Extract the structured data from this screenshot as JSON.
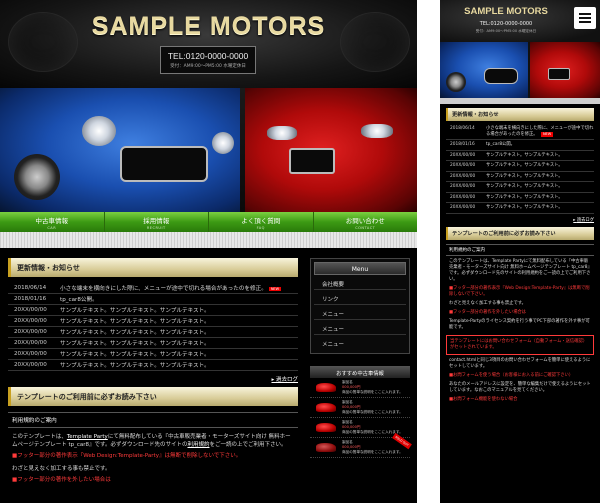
{
  "brand": {
    "logo": "SAMPLE MOTORS",
    "tel": "TEL:0120-0000-0000",
    "hours": "受付：AM9:00〜PM5:00 水曜定休日"
  },
  "nav": [
    {
      "label": "中古車情報",
      "sub": "CAR"
    },
    {
      "label": "採用情報",
      "sub": "RECRUIT"
    },
    {
      "label": "よく頂く質問",
      "sub": "FAQ"
    },
    {
      "label": "お問い合わせ",
      "sub": "CONTACT"
    }
  ],
  "news": {
    "title": "更新情報・お知らせ",
    "items": [
      {
        "date": "2018/06/14",
        "text": "小さな端末を横向きにした際に、メニューが途中で切れる場合があったのを修正。",
        "new": "NEW"
      },
      {
        "date": "2018/01/16",
        "text": "tp_car8公開。"
      },
      {
        "date": "20XX/00/00",
        "text": "サンプルテキスト。サンプルテキスト。サンプルテキスト。"
      },
      {
        "date": "20XX/00/00",
        "text": "サンプルテキスト。サンプルテキスト。サンプルテキスト。"
      },
      {
        "date": "20XX/00/00",
        "text": "サンプルテキスト。サンプルテキスト。サンプルテキスト。"
      },
      {
        "date": "20XX/00/00",
        "text": "サンプルテキスト。サンプルテキスト。サンプルテキスト。"
      },
      {
        "date": "20XX/00/00",
        "text": "サンプルテキスト。サンプルテキスト。サンプルテキスト。"
      },
      {
        "date": "20XX/00/00",
        "text": "サンプルテキスト。サンプルテキスト。サンプルテキスト。"
      }
    ],
    "archive": "過去ログ"
  },
  "template": {
    "title": "テンプレートのご利用前に必ずお読み下さい",
    "subhead": "利用規約のご案内",
    "p1_pre": "このテンプレートは、",
    "p1_link": "Template Party",
    "p1_mid": "にて無料配布している『中古車販売業者・モーターズサイト向け 無料ホームページテンプレート tp_car8』です。必ずダウンロード先のサイトの",
    "p1_link2": "利用規約",
    "p1_post": "をご一読の上でご利用下さい。",
    "red1": "■フッター部分の著作表示『Web Design:Template-Party』は無断で削除しないで下さい。",
    "p2": "わざと見えなく加工する事も禁止です。",
    "red2": "■フッター部分の著作を外したい場合は"
  },
  "side": {
    "menu_title": "Menu",
    "menu": [
      "会社概要",
      "リンク",
      "メニュー",
      "メニュー",
      "メニュー"
    ],
    "rec_title": "おすすめ中古車情報",
    "rec_items": [
      {
        "name": "製品名",
        "price": "000,000円",
        "desc": "商品の簡単な説明をここに入れます。",
        "ribbon": ""
      },
      {
        "name": "製品名",
        "price": "000,000円",
        "desc": "商品の簡単な説明をここに入れます。",
        "ribbon": ""
      },
      {
        "name": "製品名",
        "price": "000,000円",
        "desc": "商品の簡単な説明をここに入れます。",
        "ribbon": ""
      },
      {
        "name": "製品名",
        "price": "000,000円",
        "desc": "商品の簡単な説明をここに入れます。",
        "ribbon": "SOLD OUT"
      }
    ]
  },
  "mobile": {
    "news_items": [
      {
        "date": "2018/06/14",
        "text": "小さな端末を横向きにした際に、メニューが途中で切れる場合があったのを修正。",
        "new": "NEW"
      },
      {
        "date": "2018/01/16",
        "text": "tp_car8公開。"
      },
      {
        "date": "20XX/00/00",
        "text": "サンプルテキスト。サンプルテキスト。"
      },
      {
        "date": "20XX/00/00",
        "text": "サンプルテキスト。サンプルテキスト。"
      },
      {
        "date": "20XX/00/00",
        "text": "サンプルテキスト。サンプルテキスト。"
      },
      {
        "date": "20XX/00/00",
        "text": "サンプルテキスト。サンプルテキスト。"
      },
      {
        "date": "20XX/00/00",
        "text": "サンプルテキスト。サンプルテキスト。"
      },
      {
        "date": "20XX/00/00",
        "text": "サンプルテキスト。サンプルテキスト。"
      }
    ],
    "p1": "このテンプレートは、Template Partyにて無料配布している『中古車販売業者・モーターズサイト向け 無料ホームページテンプレート tp_car8』です。必ずダウンロード先のサイトの利用規約をご一読の上でご利用下さい。",
    "red1": "■フッター部分の著作表示『Web Design:Template-Party』は無断で削除しないで下さい。",
    "p2": "わざと見えなく加工する事も禁止です。",
    "red2": "■フッター部分の著作を外したい場合は",
    "p3": "Template-Partyのライセンス契約を行う事でPC下部の著作を外す事が可能です。",
    "red_box": "当テンプレートにはお問い合わせフォーム（自動フォーム・送信確認）がセットされています。",
    "p4": "contact.htmlと同じ3項目のお問い合わせフォームを簡単に使えるようにセットしています。",
    "red3": "■お問フォームを使う場合（お客様にお入る前にご確認下さい）",
    "p5": "あなたのメールアドレスに設定を、簡単な編集だけで使えるようにセットしています。なおこのマニュアルを見てください。",
    "red4": "■お問フォーム機能を使わない場合"
  },
  "colors": {
    "accent_green": "#3c9a14",
    "gold": "#d8cc98",
    "alert_red": "#ff3a3a"
  }
}
